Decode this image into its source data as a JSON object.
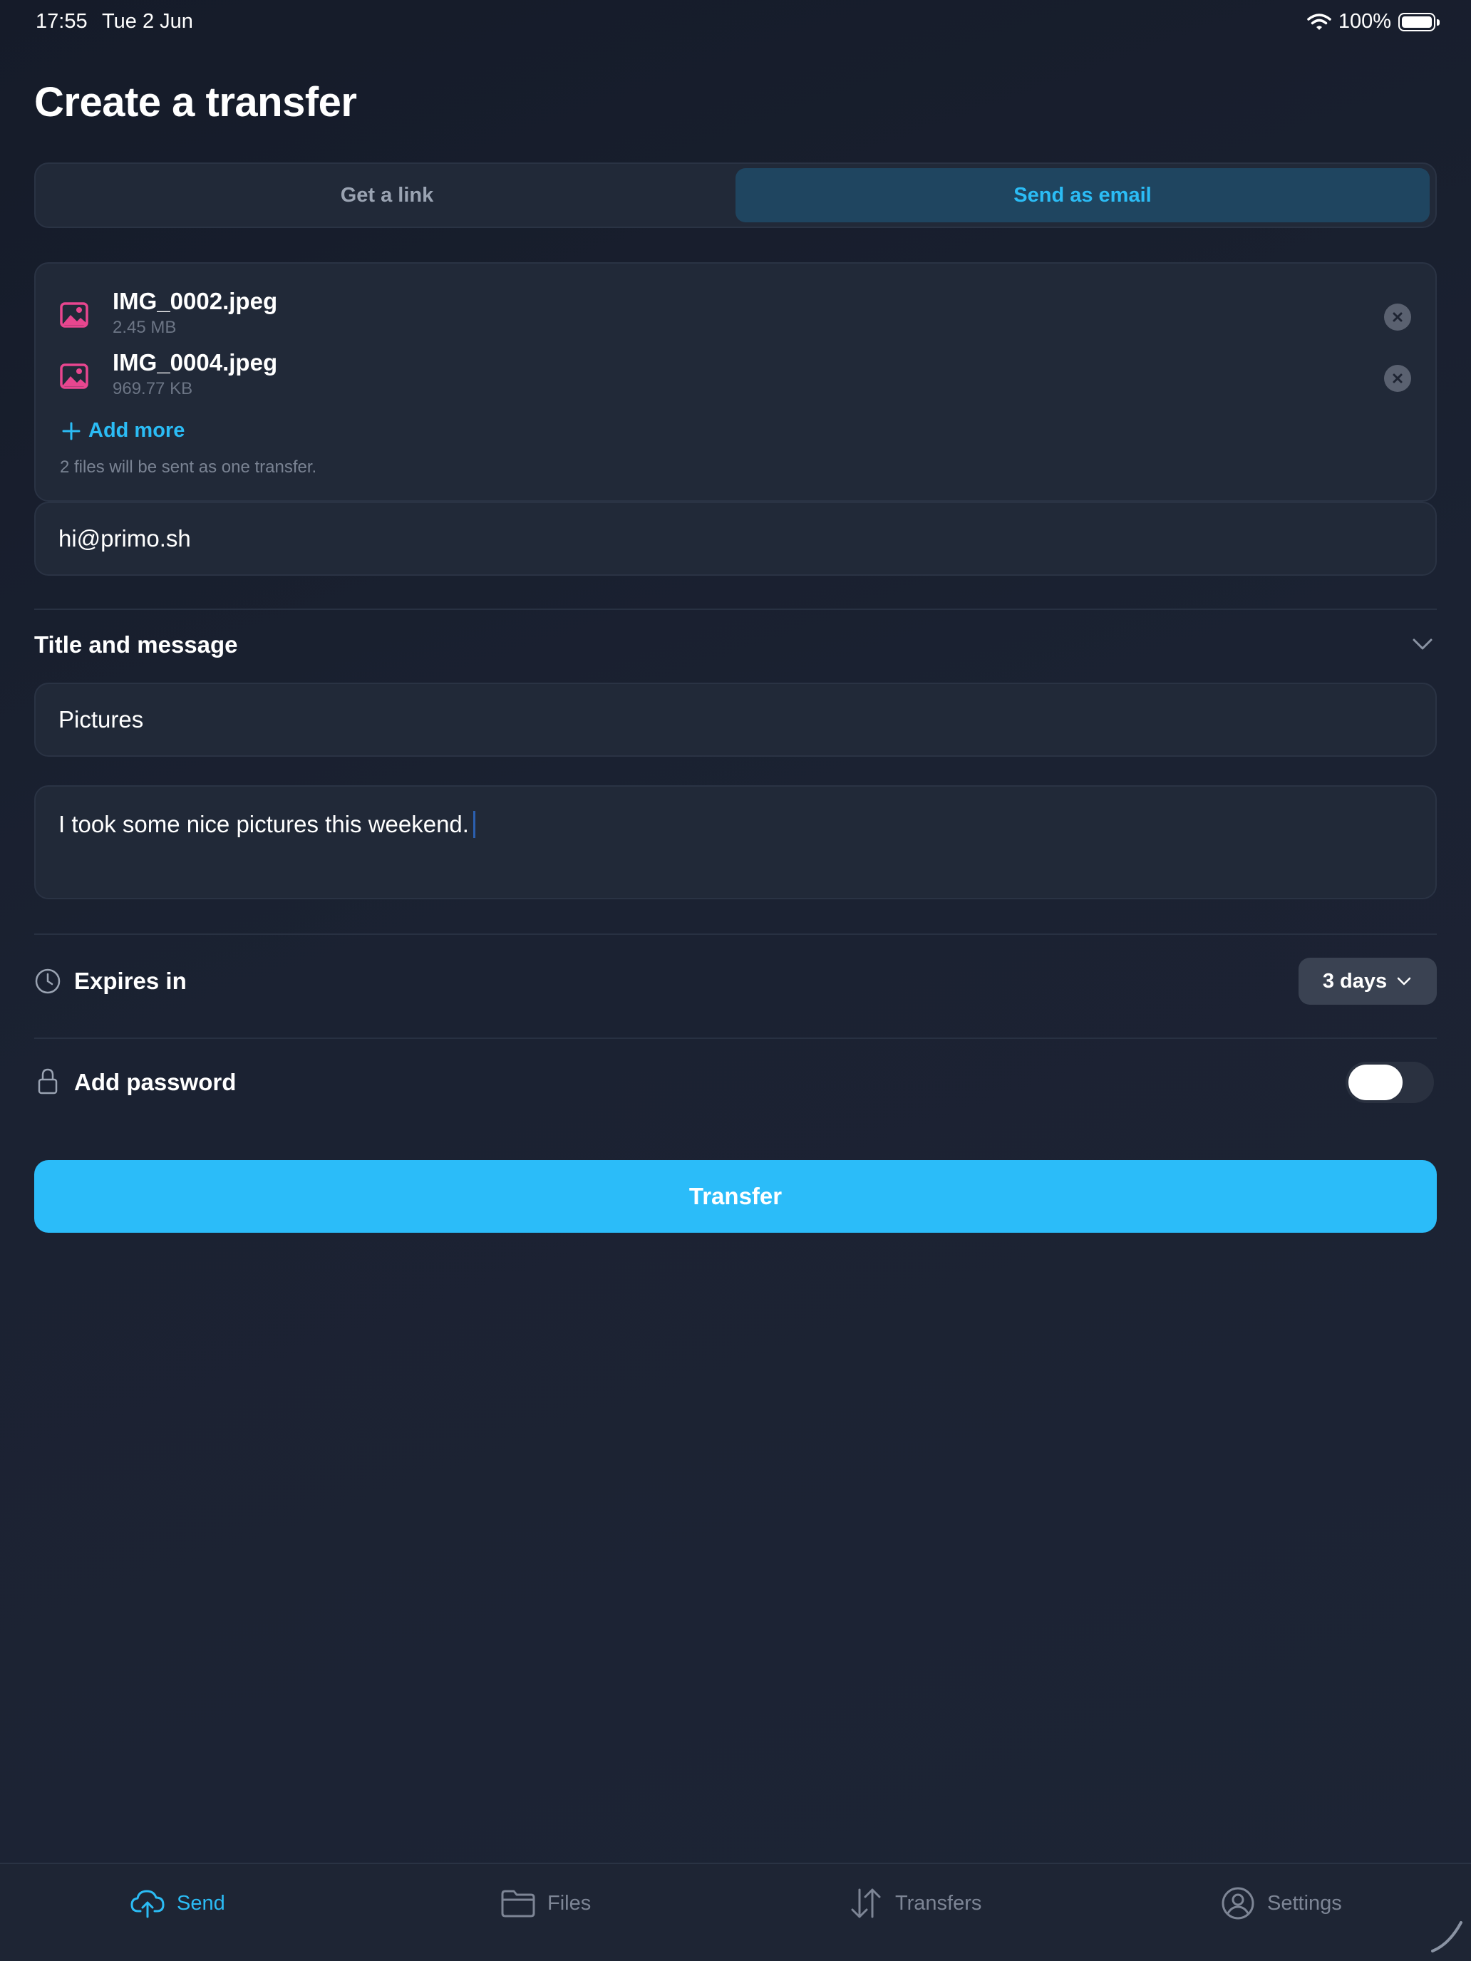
{
  "status_bar": {
    "time": "17:55",
    "date": "Tue 2 Jun",
    "battery": "100%"
  },
  "page": {
    "title": "Create a transfer"
  },
  "segmented": {
    "options": [
      "Get a link",
      "Send as email"
    ],
    "selected": "Send as email"
  },
  "files": {
    "items": [
      {
        "name": "IMG_0002.jpeg",
        "size": "2.45 MB"
      },
      {
        "name": "IMG_0004.jpeg",
        "size": "969.77 KB"
      }
    ],
    "add_more_label": "Add more",
    "note": "2 files will be sent as one transfer."
  },
  "email": {
    "value": "hi@primo.sh"
  },
  "title_message": {
    "header": "Title and message",
    "title_value": "Pictures",
    "message_value": "I took some nice pictures this weekend."
  },
  "expires": {
    "label": "Expires in",
    "value": "3 days"
  },
  "password": {
    "label": "Add password",
    "enabled": false
  },
  "transfer_button": {
    "label": "Transfer"
  },
  "tab_bar": {
    "tabs": [
      {
        "label": "Send",
        "icon": "cloud-upload-icon",
        "active": true
      },
      {
        "label": "Files",
        "icon": "folder-icon",
        "active": false
      },
      {
        "label": "Transfers",
        "icon": "arrows-up-down-icon",
        "active": false
      },
      {
        "label": "Settings",
        "icon": "user-circle-icon",
        "active": false
      }
    ]
  },
  "colors": {
    "accent": "#2bbcf5",
    "background": "#171d2b",
    "card": "#212938",
    "file_icon": "#e8468f",
    "primary_button": "#2bbcf9"
  }
}
